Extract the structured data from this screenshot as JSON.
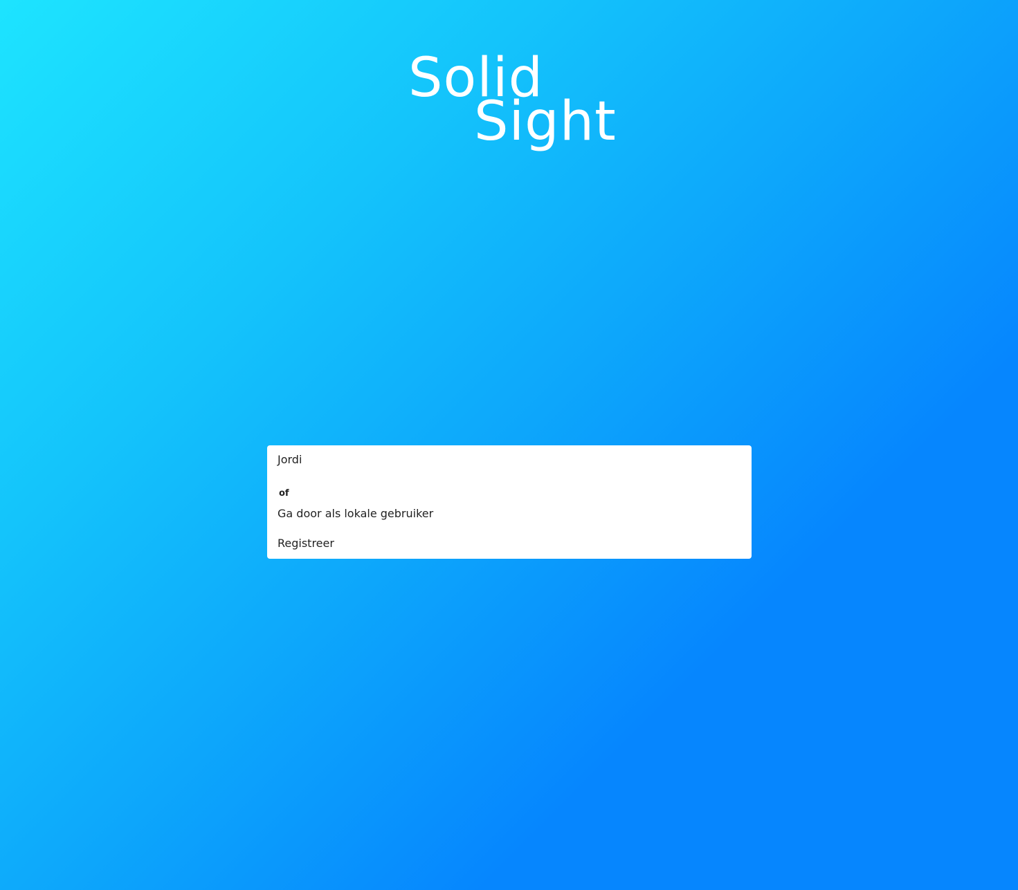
{
  "logo": {
    "line1": "Solid",
    "line2": "Sight"
  },
  "login_card": {
    "account_name": "Jordi",
    "separator": "of",
    "local_user_label": "Ga door als lokale gebruiker",
    "register_label": "Registreer"
  },
  "colors": {
    "gradient_start": "#1de4ff",
    "gradient_end": "#0686fe",
    "card_background": "#ffffff",
    "text": "#222222"
  }
}
